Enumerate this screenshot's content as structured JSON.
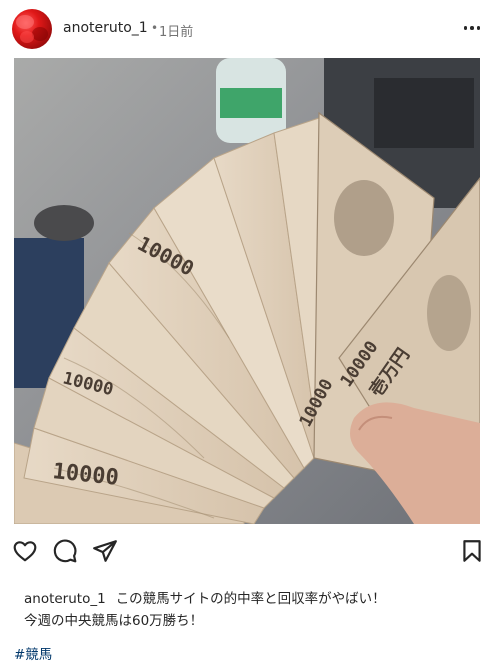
{
  "post": {
    "username": "anoteruto_1",
    "separator": "•",
    "time_ago": "1日前",
    "caption_username": "anoteruto_1",
    "caption_line1": "この競馬サイトの的中率と回収率がやばい！",
    "caption_line2": "今週の中央競馬は60万勝ち！",
    "hashtag": "#競馬"
  },
  "icons": {
    "avatar": "red-rose-avatar",
    "more": "more-options-icon",
    "like": "heart-icon",
    "comment": "comment-icon",
    "share": "share-icon",
    "save": "bookmark-icon"
  },
  "photo": {
    "note_numeral": "10000",
    "note_kanji": "壱万円"
  },
  "colors": {
    "text": "#262626",
    "muted": "#737373",
    "hashtag": "#00376b",
    "avatar_red": "#e01818"
  }
}
